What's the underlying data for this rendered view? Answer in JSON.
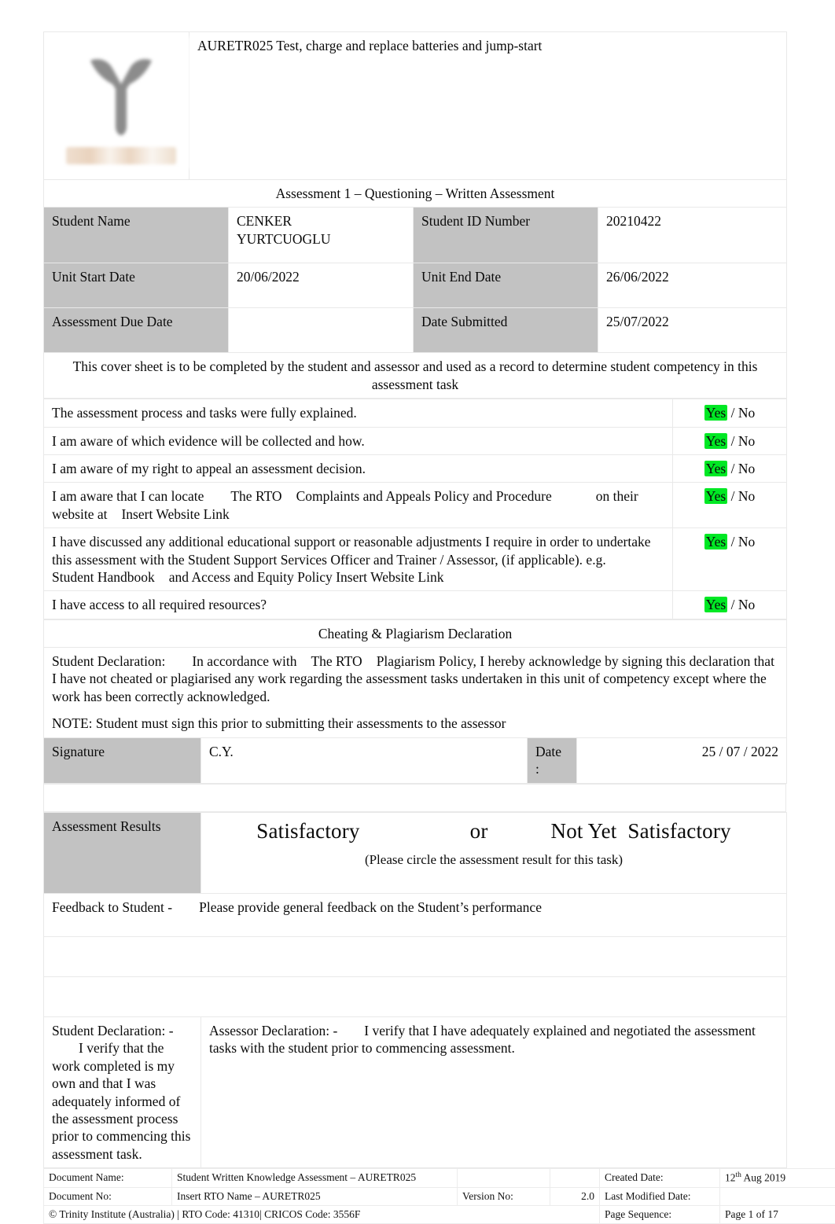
{
  "header": {
    "logo_name": "trinity-institute-logo",
    "unit_title": "AURETR025 Test, charge and replace batteries and jump-start",
    "assessment_title": "Assessment 1 – Questioning – Written Assessment"
  },
  "student_info": {
    "student_name_label": "Student Name",
    "student_name_value": "CENKER YURTCUOGLU",
    "student_id_label": "Student ID Number",
    "student_id_value": "20210422",
    "unit_start_label": "Unit Start Date",
    "unit_start_value": "20/06/2022",
    "unit_end_label": "Unit End Date",
    "unit_end_value": "26/06/2022",
    "due_date_label": "Assessment Due Date",
    "due_date_value": "",
    "date_submitted_label": "Date Submitted",
    "date_submitted_value": "25/07/2022"
  },
  "cover_note": "This cover sheet is to be completed by the student and assessor and used as a record to determine student competency in this assessment task",
  "checklist": {
    "yes_label": "Yes",
    "separator": " / ",
    "no_label": "No",
    "items": [
      {
        "text": "The assessment process and tasks were fully explained.",
        "answer": "Yes"
      },
      {
        "text": "I am aware of which evidence will be collected and how.",
        "answer": "Yes"
      },
      {
        "text": "I am aware of my right to appeal an assessment decision.",
        "answer": "Yes"
      },
      {
        "text_part1": "I am aware that I can locate",
        "text_part2": "The RTO",
        "text_part3": "Complaints and Appeals Policy and Procedure",
        "text_part4": "on their website at",
        "text_part5": "Insert Website Link",
        "answer": "Yes"
      },
      {
        "text_part1": "I have discussed any additional educational support or reasonable adjustments I require in order to undertake this assessment with the Student Support Services Officer and Trainer / Assessor, (if applicable). e.g.",
        "text_part2": "Student Handbook",
        "text_part3": "and",
        "text_part4": "Access and Equity Policy Insert Website Link",
        "answer": "Yes"
      },
      {
        "text": "I have access to all required resources?",
        "answer": "Yes"
      }
    ]
  },
  "plagiarism": {
    "heading": "Cheating & Plagiarism Declaration",
    "declaration_label": "Student Declaration:",
    "declaration_part1": "In accordance with",
    "declaration_part2": "The RTO",
    "declaration_part3": "Plagiarism Policy, I hereby acknowledge by signing this declaration that I have not cheated or plagiarised any work regarding the assessment tasks undertaken in this unit of competency except where the work has been correctly acknowledged.",
    "note": "NOTE: Student must sign this prior to submitting their assessments to the assessor"
  },
  "signature": {
    "signature_label": "Signature",
    "signature_value": "C.Y.",
    "date_label": "Date",
    "date_colon": ":",
    "date_value": "25 / 07 / 2022"
  },
  "results": {
    "label": "Assessment Results",
    "option_satisfactory": "Satisfactory",
    "option_or": "or",
    "option_not_yet": "Not Yet",
    "option_not_yet_satisfactory": "Satisfactory",
    "note": "(Please circle the assessment result for this task)",
    "feedback_label": "Feedback to Student -",
    "feedback_prompt": "Please provide general feedback on the Student’s performance"
  },
  "declarations": {
    "student_label": "Student Declaration: -",
    "student_text": "I verify that the work completed is my own and that I was adequately informed of the assessment process prior to commencing this assessment task.",
    "assessor_label": "Assessor Declaration: -",
    "assessor_text": "I verify that I have adequately explained and negotiated the assessment tasks with the student prior to commencing assessment."
  },
  "footer": {
    "document_name_label": "Document Name:",
    "document_name_value": "Student Written Knowledge Assessment – AURETR025",
    "document_no_label": "Document No:",
    "document_no_value": "Insert RTO Name    – AURETR025",
    "version_label": "Version No:",
    "version_value": "2.0",
    "created_date_label": "Created Date:",
    "created_date_value_num": "12",
    "created_date_value_sup": "th",
    "created_date_value_rest": " Aug 2019",
    "last_modified_label": "Last Modified Date:",
    "last_modified_value": "",
    "copyright": "© Trinity Institute (Australia) | RTO Code: 41310| CRICOS Code: 3556F",
    "page_sequence_label": "Page Sequence:",
    "page_sequence_value": "Page   1 of 17"
  }
}
